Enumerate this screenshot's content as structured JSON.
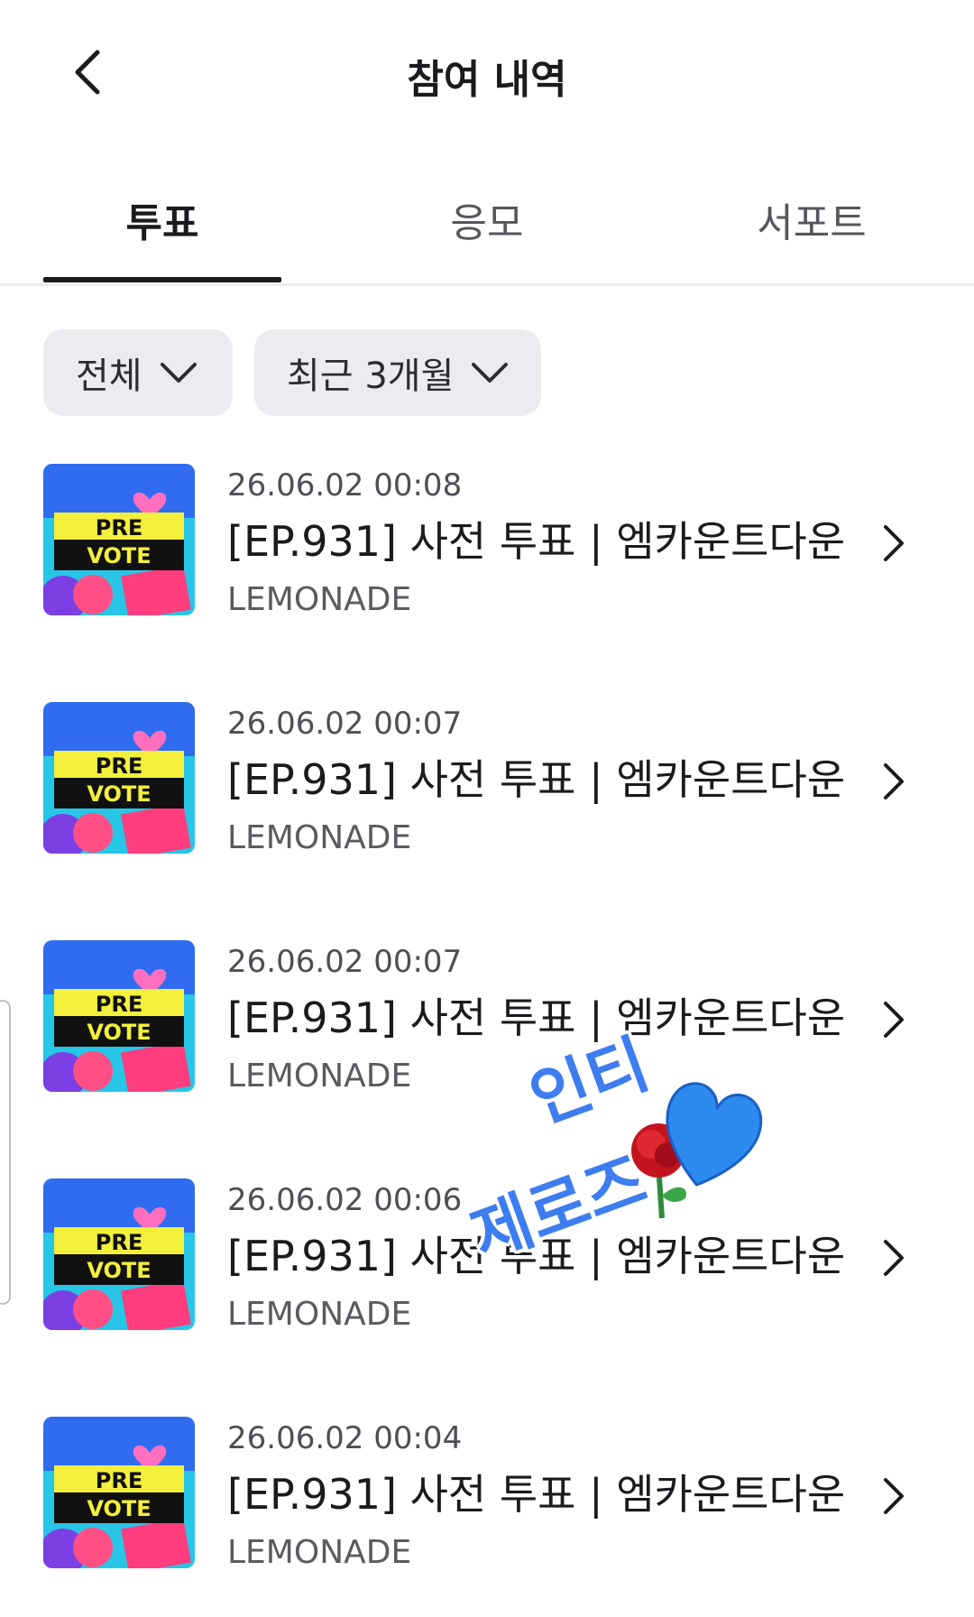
{
  "header": {
    "title": "참여 내역"
  },
  "tabs": [
    {
      "label": "투표",
      "active": true
    },
    {
      "label": "응모",
      "active": false
    },
    {
      "label": "서포트",
      "active": false
    }
  ],
  "filters": [
    {
      "label": "전체"
    },
    {
      "label": "최근 3개월"
    }
  ],
  "items": [
    {
      "date": "26.06.02 00:08",
      "title": "[EP.931] 사전 투표 | 엠카운트다운",
      "source": "LEMONADE",
      "thumb_text_1": "PRE",
      "thumb_text_2": "VOTE"
    },
    {
      "date": "26.06.02 00:07",
      "title": "[EP.931] 사전 투표 | 엠카운트다운",
      "source": "LEMONADE",
      "thumb_text_1": "PRE",
      "thumb_text_2": "VOTE"
    },
    {
      "date": "26.06.02 00:07",
      "title": "[EP.931] 사전 투표 | 엠카운트다운",
      "source": "LEMONADE",
      "thumb_text_1": "PRE",
      "thumb_text_2": "VOTE"
    },
    {
      "date": "26.06.02 00:06",
      "title": "[EP.931] 사전 투표 | 엠카운트다운",
      "source": "LEMONADE",
      "thumb_text_1": "PRE",
      "thumb_text_2": "VOTE"
    },
    {
      "date": "26.06.02 00:04",
      "title": "[EP.931] 사전 투표 | 엠카운트다운",
      "source": "LEMONADE",
      "thumb_text_1": "PRE",
      "thumb_text_2": "VOTE"
    }
  ],
  "sticker": {
    "line1": "인티",
    "line2": "제로즈"
  },
  "colors": {
    "accent_text": "#1b1b1f",
    "chip_bg": "#ececf0",
    "sticker_blue": "#3d7df0"
  }
}
